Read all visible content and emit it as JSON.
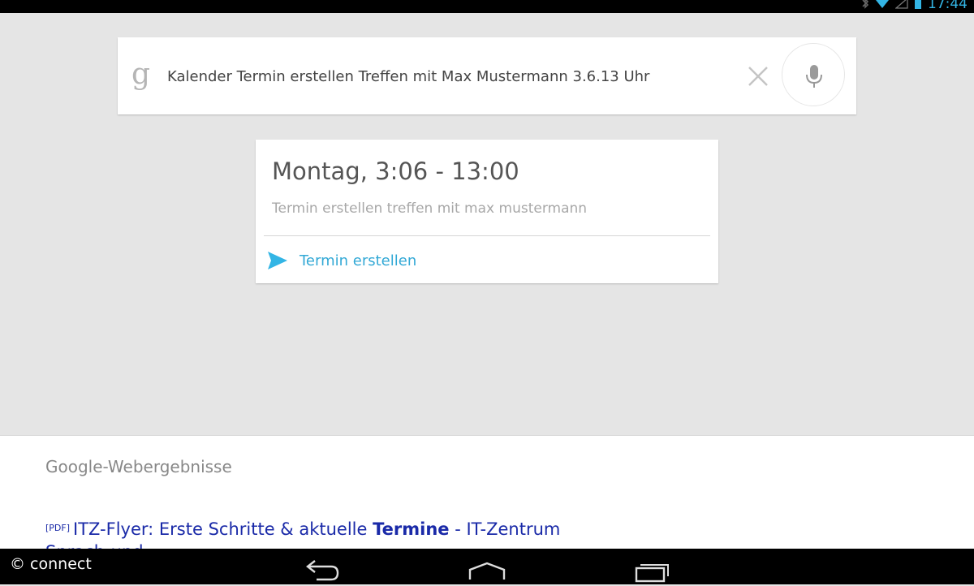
{
  "status_bar": {
    "clock": "17:44",
    "icons": [
      "bluetooth-icon",
      "wifi-icon",
      "signal-icon",
      "battery-icon"
    ]
  },
  "search": {
    "logo": "g",
    "query": "Kalender Termin erstellen Treffen mit Max Mustermann 3.6.13 Uhr"
  },
  "card": {
    "title": "Montag, 3:06 - 13:00",
    "subtitle": "Termin erstellen treffen mit max mustermann",
    "action_label": "Termin erstellen"
  },
  "results": {
    "header": "Google-Webergebnisse",
    "first": {
      "tag": "[PDF]",
      "text_before": "ITZ-Flyer: Erste Schritte & aktuelle ",
      "bold": "Termine",
      "text_after": " - IT-Zentrum Sprach-und"
    }
  },
  "watermark": "© connect",
  "colors": {
    "accent": "#33b5e5",
    "link": "#1a2aa8",
    "background": "#e5e5e5"
  }
}
